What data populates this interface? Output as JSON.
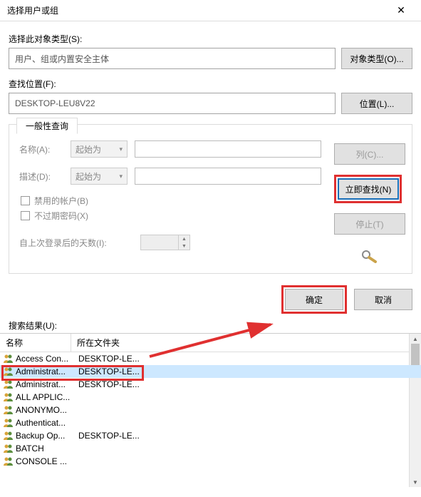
{
  "title": "选择用户或组",
  "labels": {
    "object_type": "选择此对象类型(S):",
    "from_location": "查找位置(F):",
    "general_query_tab": "一般性查询",
    "name": "名称(A):",
    "desc": "描述(D):",
    "disabled_acct": "禁用的帐户(B)",
    "no_expire_pwd": "不过期密码(X)",
    "days_since_login": "自上次登录后的天数(I):",
    "search_results": "搜索结果(U):",
    "col_name": "名称",
    "col_folder": "所在文件夹"
  },
  "values": {
    "object_type_text": "用户、组或内置安全主体",
    "location_text": "DESKTOP-LEU8V22",
    "combo_starts_with": "起始为"
  },
  "buttons": {
    "object_types": "对象类型(O)...",
    "locations": "位置(L)...",
    "columns": "列(C)...",
    "find_now": "立即查找(N)",
    "stop": "停止(T)",
    "ok": "确定",
    "cancel": "取消"
  },
  "rows": [
    {
      "name": "Access Con...",
      "folder": "DESKTOP-LE..."
    },
    {
      "name": "Administrat...",
      "folder": "DESKTOP-LE...",
      "selected": true
    },
    {
      "name": "Administrat...",
      "folder": "DESKTOP-LE..."
    },
    {
      "name": "ALL APPLIC...",
      "folder": ""
    },
    {
      "name": "ANONYMO...",
      "folder": ""
    },
    {
      "name": "Authenticat...",
      "folder": ""
    },
    {
      "name": "Backup Op...",
      "folder": "DESKTOP-LE..."
    },
    {
      "name": "BATCH",
      "folder": ""
    },
    {
      "name": "CONSOLE ...",
      "folder": ""
    }
  ]
}
